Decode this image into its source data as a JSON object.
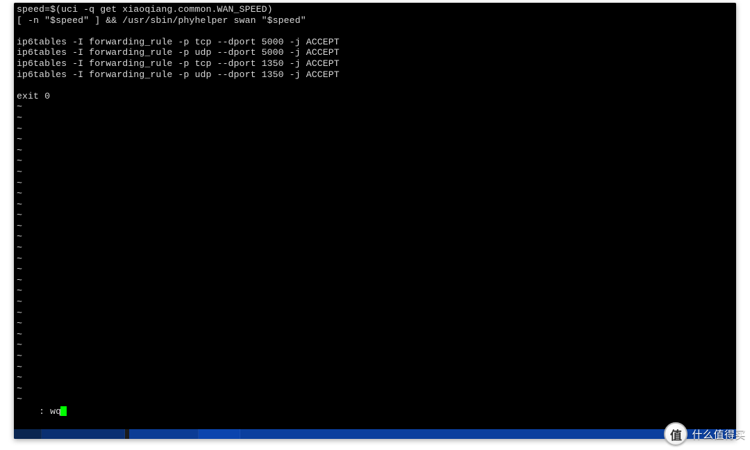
{
  "editor": {
    "lines": [
      "speed=$(uci -q get xiaoqiang.common.WAN_SPEED)",
      "[ -n \"$speed\" ] && /usr/sbin/phyhelper swan \"$speed\"",
      "",
      "ip6tables -I forwarding_rule -p tcp --dport 5000 -j ACCEPT",
      "ip6tables -I forwarding_rule -p udp --dport 5000 -j ACCEPT",
      "ip6tables -I forwarding_rule -p tcp --dport 1350 -j ACCEPT",
      "ip6tables -I forwarding_rule -p udp --dport 1350 -j ACCEPT",
      "",
      "exit 0"
    ],
    "tilde": "~",
    "command_prefix": ": ",
    "command_text": "wq"
  },
  "watermark": {
    "badge_char": "值",
    "text": "什么值得买"
  }
}
